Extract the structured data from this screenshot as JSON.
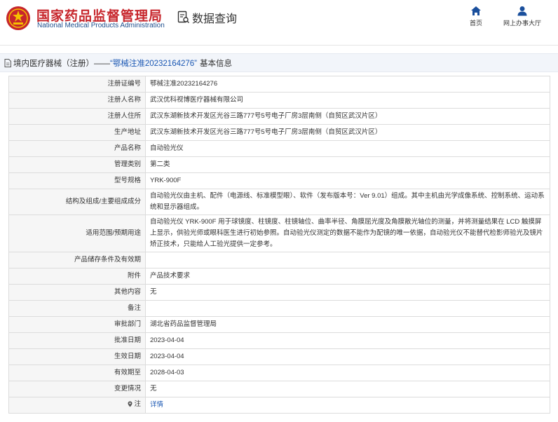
{
  "header": {
    "brand_cn": "国家药品监督管理局",
    "brand_en": "National Medical Products Administration",
    "query_title": "数据查询",
    "nav": {
      "home_label": "首页",
      "hall_label": "网上办事大厅"
    },
    "accent_color": "#c7262c",
    "brand_blue": "#1f4f8e"
  },
  "breadcrumb": {
    "prefix": "境内医疗器械（注册）——",
    "highlight": "“鄂械注准20232164276”",
    "suffix": "基本信息"
  },
  "rows": [
    {
      "key": "注册证编号",
      "value": "鄂械注准20232164276"
    },
    {
      "key": "注册人名称",
      "value": "武汉优科视博医疗器械有限公司"
    },
    {
      "key": "注册人住所",
      "value": "武汉东湖新技术开发区光谷三路777号5号电子厂房3层南侧（自贸区武汉片区）"
    },
    {
      "key": "生产地址",
      "value": "武汉东湖新技术开发区光谷三路777号5号电子厂房3层南侧（自贸区武汉片区）"
    },
    {
      "key": "产品名称",
      "value": "自动验光仪"
    },
    {
      "key": "管理类别",
      "value": "第二类"
    },
    {
      "key": "型号规格",
      "value": "YRK-900F"
    },
    {
      "key": "结构及组成/主要组成成分",
      "value": "自动验光仪由主机、配件（电源线、标准模型眼）、软件（发布版本号：Ver 9.01）组成。其中主机由光学成像系统、控制系统、运动系统和显示器组成。"
    },
    {
      "key": "适用范围/预期用途",
      "value": "自动验光仪 YRK-900F 用于球镜度、柱镜度、柱镜轴位、曲率半径、角膜屈光度及角膜散光轴位的测量，并将测量结果在 LCD 触摸屏上显示，供验光师或眼科医生进行初始参照。自动验光仪测定的数据不能作为配镜的唯一依据，自动验光仪不能替代检影师验光及镜片矫正技术，只能给人工验光提供一定参考。"
    },
    {
      "key": "产品储存条件及有效期",
      "value": ""
    },
    {
      "key": "附件",
      "value": "产品技术要求"
    },
    {
      "key": "其他内容",
      "value": "无"
    },
    {
      "key": "备注",
      "value": ""
    },
    {
      "key": "审批部门",
      "value": "湖北省药品监督管理局"
    },
    {
      "key": "批准日期",
      "value": "2023-04-04"
    },
    {
      "key": "生效日期",
      "value": "2023-04-04"
    },
    {
      "key": "有效期至",
      "value": "2028-04-03"
    },
    {
      "key": "变更情况",
      "value": "无"
    },
    {
      "key": "注",
      "value": "详情"
    }
  ]
}
